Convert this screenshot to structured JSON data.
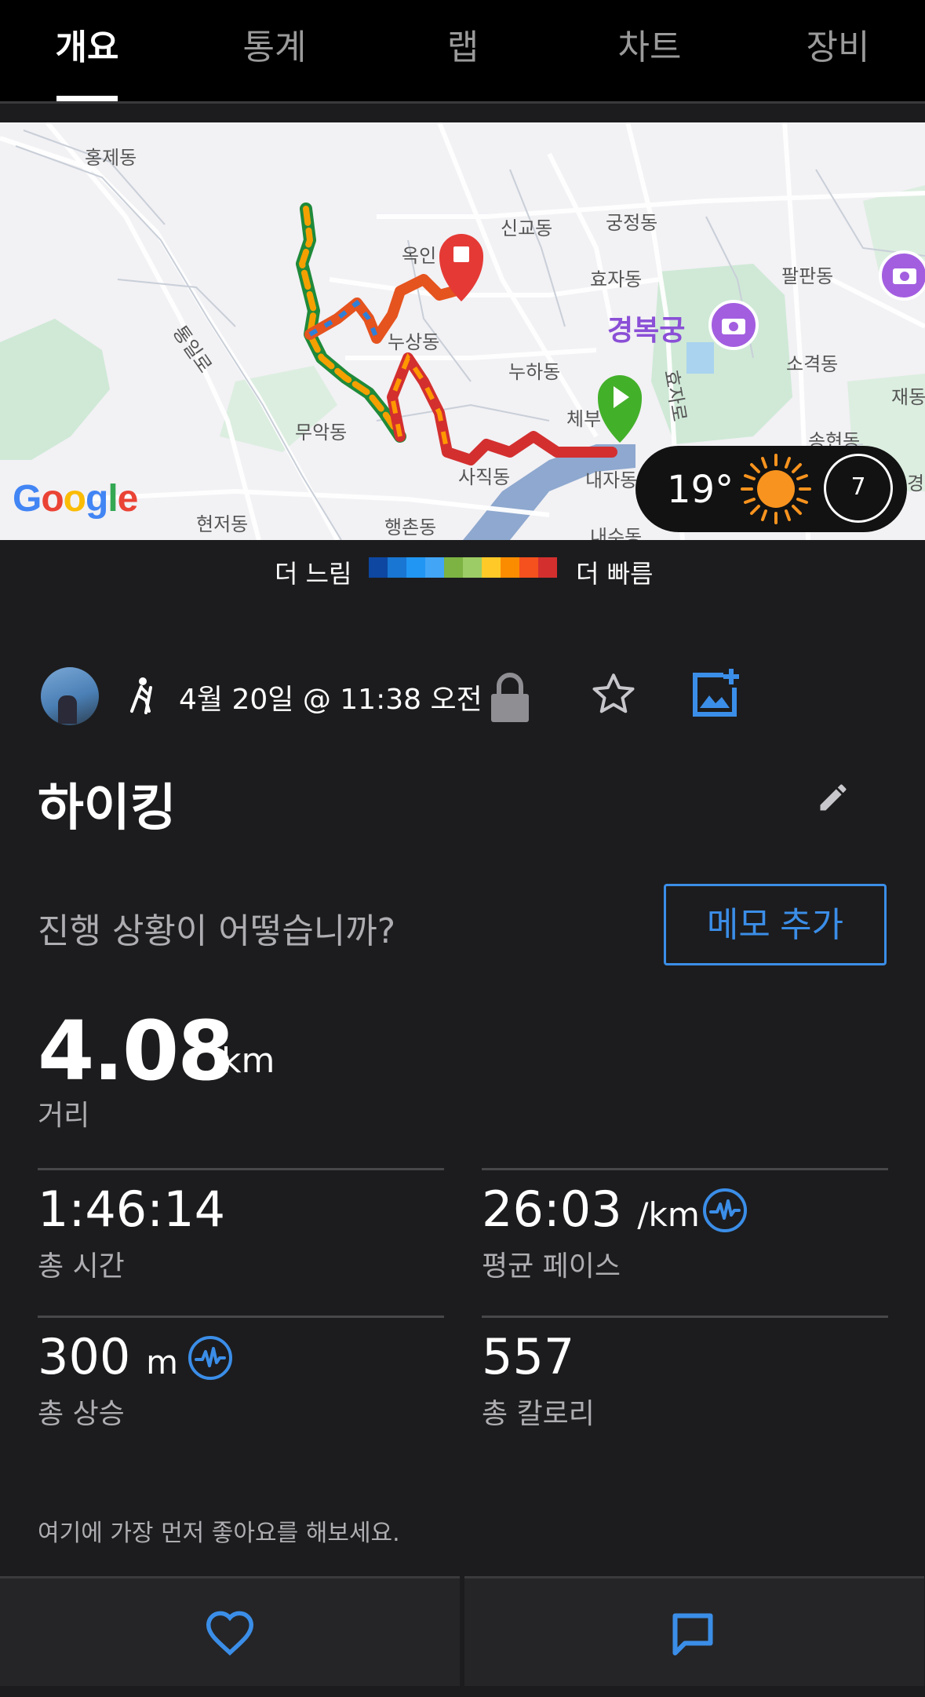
{
  "tabs": [
    {
      "label": "개요",
      "active": true
    },
    {
      "label": "통계",
      "active": false
    },
    {
      "label": "랩",
      "active": false
    },
    {
      "label": "차트",
      "active": false
    },
    {
      "label": "장비",
      "active": false
    }
  ],
  "map": {
    "labels": {
      "hongje": "홍제동",
      "singyo": "신교동",
      "gungjeong": "궁정동",
      "ogin": "옥인",
      "hyoja": "효자동",
      "palpan": "팔판동",
      "tongil": "통일로",
      "nusang": "누상동",
      "gyeongbokgung": "경복궁",
      "nuha": "누하동",
      "sogyeok": "소격동",
      "jae": "재동",
      "hyoja_ro": "효자로",
      "muak": "무악동",
      "chebu": "체부",
      "songhyeon": "송현동",
      "sajik": "사직동",
      "naeja": "내자동",
      "hyeonjeo": "현저동",
      "haengchon": "행촌동",
      "naesu": "내수동",
      "gyeong": "경"
    },
    "attribution": "Google",
    "weather": {
      "temperature": "19°",
      "wind": "7",
      "icon": "sun-icon"
    },
    "legend": {
      "slow_label": "더 느림",
      "fast_label": "더 빠름",
      "colors": [
        "#0d47a1",
        "#1976d2",
        "#2196f3",
        "#42a5f5",
        "#7cb342",
        "#9ccc65",
        "#ffca28",
        "#fb8c00",
        "#f4511e",
        "#d32f2f"
      ]
    }
  },
  "activity": {
    "date": "4월 20일 @ 11:38 오전",
    "title": "하이킹",
    "prompt": "진행 상황이 어떻습니까?",
    "memo_button": "메모 추가",
    "distance": {
      "value": "4.08",
      "unit": "km",
      "label": "거리"
    },
    "stats": {
      "total_time": {
        "value": "1:46:14",
        "label": "총 시간"
      },
      "avg_pace": {
        "value": "26:03",
        "unit": "/km",
        "label": "평균 페이스"
      },
      "total_ascent": {
        "value": "300",
        "unit": "m",
        "label": "총 상승"
      },
      "calories": {
        "value": "557",
        "label": "총 칼로리"
      }
    },
    "like_prompt": "여기에 가장 먼저 좋아요를 해보세요."
  },
  "colors": {
    "accent": "#3b8ee8",
    "background": "#1c1c1e",
    "tab_bar": "#000000",
    "start_pin": "#43b02a",
    "end_pin": "#e53935",
    "poi": "#a35ee0"
  }
}
